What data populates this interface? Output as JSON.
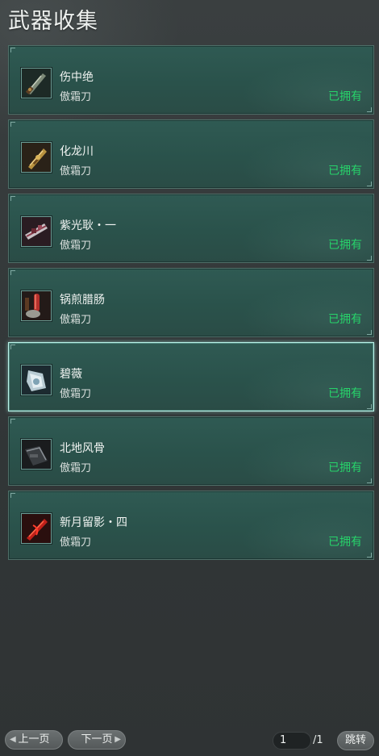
{
  "title": "武器收集",
  "weapons": [
    {
      "name": "伤中绝",
      "type": "傲霜刀",
      "status": "已拥有",
      "icon": "dark-green-blade-icon"
    },
    {
      "name": "化龙川",
      "type": "傲霜刀",
      "status": "已拥有",
      "icon": "golden-dragon-blade-icon"
    },
    {
      "name": "紫光耿・一",
      "type": "傲霜刀",
      "status": "已拥有",
      "icon": "purple-light-blade-icon"
    },
    {
      "name": "锅煎腊肠",
      "type": "傲霜刀",
      "status": "已拥有",
      "icon": "sausage-pan-blade-icon"
    },
    {
      "name": "碧薇",
      "type": "傲霜刀",
      "status": "已拥有",
      "icon": "silver-blue-blade-icon",
      "selected": true
    },
    {
      "name": "北地风骨",
      "type": "傲霜刀",
      "status": "已拥有",
      "icon": "dark-steel-blade-icon"
    },
    {
      "name": "新月留影・四",
      "type": "傲霜刀",
      "status": "已拥有",
      "icon": "red-crescent-blade-icon"
    }
  ],
  "pager": {
    "prev_label": "上一页",
    "next_label": "下一页",
    "current_page": "1",
    "total_pages": "/1",
    "jump_label": "跳转"
  },
  "colors": {
    "owned_status": "#27d36a",
    "card_background": "#2c554e",
    "selected_border": "#b9f2e8",
    "page_background": "#33383a"
  }
}
